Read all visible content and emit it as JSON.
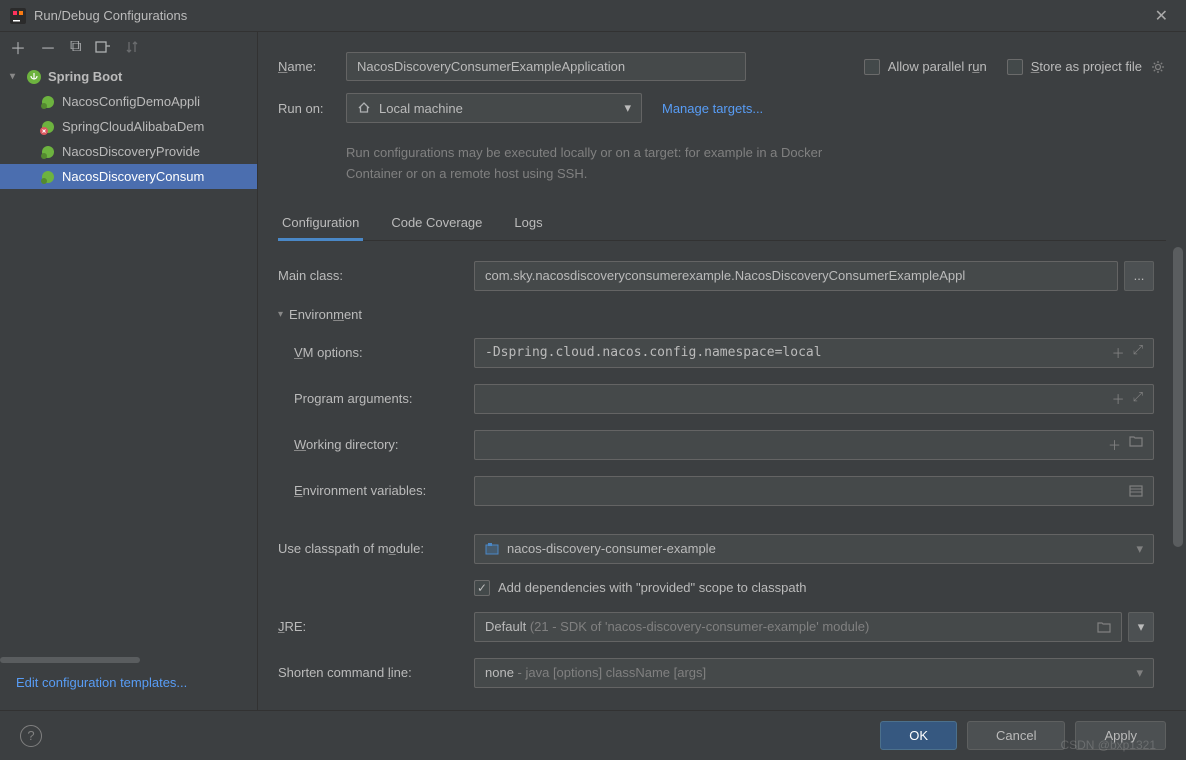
{
  "window": {
    "title": "Run/Debug Configurations"
  },
  "sidebar": {
    "root": "Spring Boot",
    "items": [
      {
        "label": "NacosConfigDemoAppli",
        "error": false
      },
      {
        "label": "SpringCloudAlibabaDem",
        "error": true
      },
      {
        "label": "NacosDiscoveryProvide",
        "error": false
      },
      {
        "label": "NacosDiscoveryConsum",
        "error": false
      }
    ],
    "editTemplates": "Edit configuration templates..."
  },
  "form": {
    "nameLabel": "Name:",
    "nameValue": "NacosDiscoveryConsumerExampleApplication",
    "parallelRun": "Allow parallel run",
    "storeAsFile": "Store as project file",
    "runOnLabel": "Run on:",
    "runOnValue": "Local machine",
    "manageTargets": "Manage targets...",
    "hint": "Run configurations may be executed locally or on a target: for example in a Docker Container or on a remote host using SSH."
  },
  "tabs": {
    "items": [
      "Configuration",
      "Code Coverage",
      "Logs"
    ],
    "activeIndex": 0
  },
  "config": {
    "mainClassLabel": "Main class:",
    "mainClassValue": "com.sky.nacosdiscoveryconsumerexample.NacosDiscoveryConsumerExampleAppl",
    "envSection": "Environment",
    "vmLabel": "VM options:",
    "vmValue": "-Dspring.cloud.nacos.config.namespace=local",
    "argsLabel": "Program arguments:",
    "argsValue": "",
    "wdLabel": "Working directory:",
    "wdValue": "",
    "envVarsLabel": "Environment variables:",
    "envVarsValue": "",
    "classpathLabel": "Use classpath of module:",
    "classpathValue": "nacos-discovery-consumer-example",
    "depsCheckbox": "Add dependencies with \"provided\" scope to classpath",
    "jreLabel": "JRE:",
    "jreValue": "Default",
    "jreHint": "(21 - SDK of 'nacos-discovery-consumer-example' module)",
    "shortenLabel": "Shorten command line:",
    "shortenValue": "none",
    "shortenHint": "- java [options] className [args]"
  },
  "buttons": {
    "ok": "OK",
    "cancel": "Cancel",
    "apply": "Apply"
  },
  "watermark": "CSDN @bxp1321"
}
